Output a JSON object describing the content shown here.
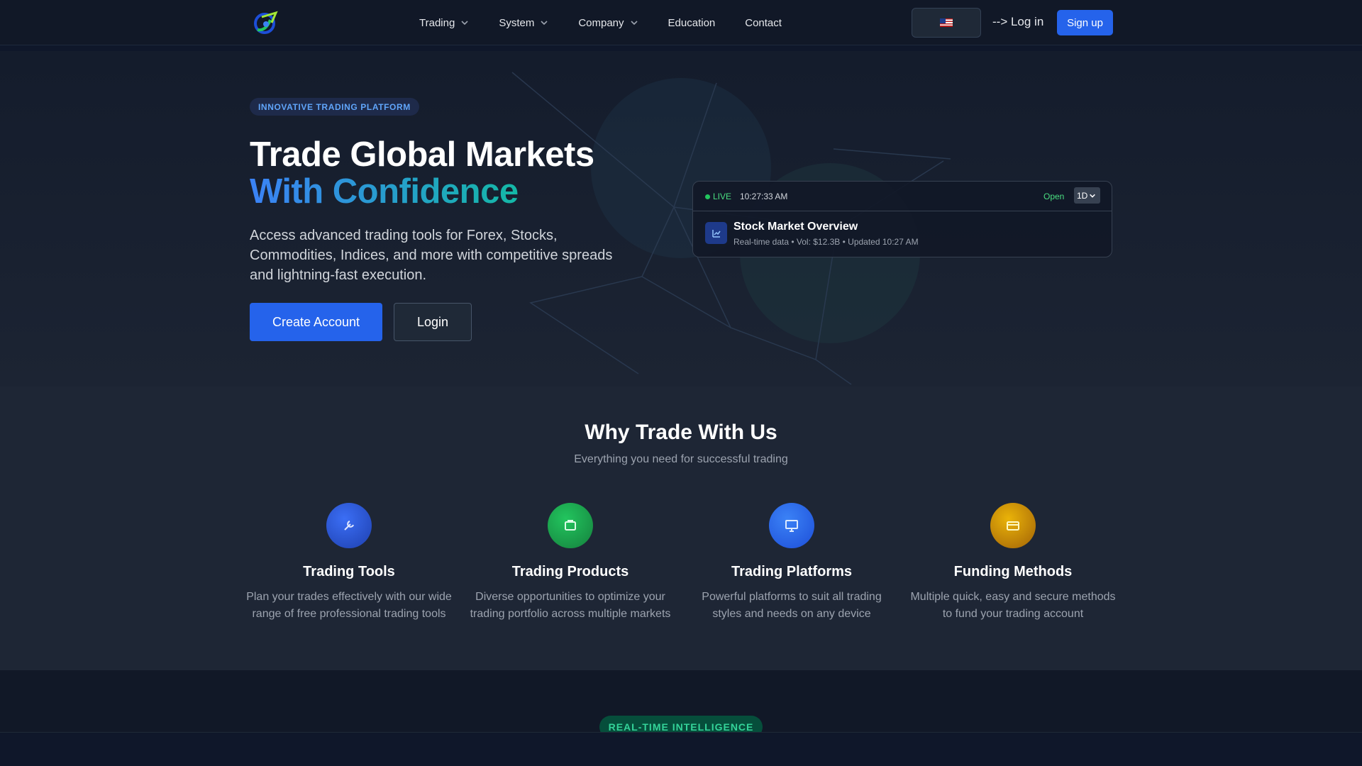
{
  "nav": {
    "items": [
      {
        "label": "Trading",
        "dropdown": true
      },
      {
        "label": "System",
        "dropdown": true
      },
      {
        "label": "Company",
        "dropdown": true
      },
      {
        "label": "Education",
        "dropdown": false
      },
      {
        "label": "Contact",
        "dropdown": false
      }
    ],
    "login_label": "-->⁠ Log in",
    "signup_label": "Sign up",
    "language_flag": "us-flag-icon"
  },
  "hero": {
    "badge": "INNOVATIVE TRADING PLATFORM",
    "title_line1": "Trade Global Markets",
    "title_line2": "With Confidence",
    "description": "Access advanced trading tools for Forex, Stocks, Commodities, Indices, and more with competitive spreads and lightning-fast execution.",
    "primary_button": "Create Account",
    "secondary_button": "Login",
    "accent_gradient": [
      "#3b82f6",
      "#14b8a6"
    ]
  },
  "widget": {
    "live_label": "LIVE",
    "time": "10:27:33 AM",
    "status": "Open",
    "period": "1D",
    "title": "Stock Market Overview",
    "subtitle": "Real-time data • Vol: $12.3B • Updated 10:27 AM"
  },
  "why": {
    "title": "Why Trade With Us",
    "subtitle": "Everything you need for successful trading",
    "features": [
      {
        "title": "Trading Tools",
        "description": "Plan your trades effectively with our wide range of free professional trading tools",
        "icon": "tools-icon",
        "color": "#2563eb"
      },
      {
        "title": "Trading Products",
        "description": "Diverse opportunities to optimize your trading portfolio across multiple markets",
        "icon": "products-icon",
        "color": "#16a34a"
      },
      {
        "title": "Trading Platforms",
        "description": "Powerful platforms to suit all trading styles and needs on any device",
        "icon": "platforms-icon",
        "color": "#2563eb"
      },
      {
        "title": "Funding Methods",
        "description": "Multiple quick, easy and secure methods to fund your trading account",
        "icon": "funding-icon",
        "color": "#ca8a04"
      }
    ]
  },
  "bottom": {
    "badge": "REAL-TIME INTELLIGENCE"
  }
}
